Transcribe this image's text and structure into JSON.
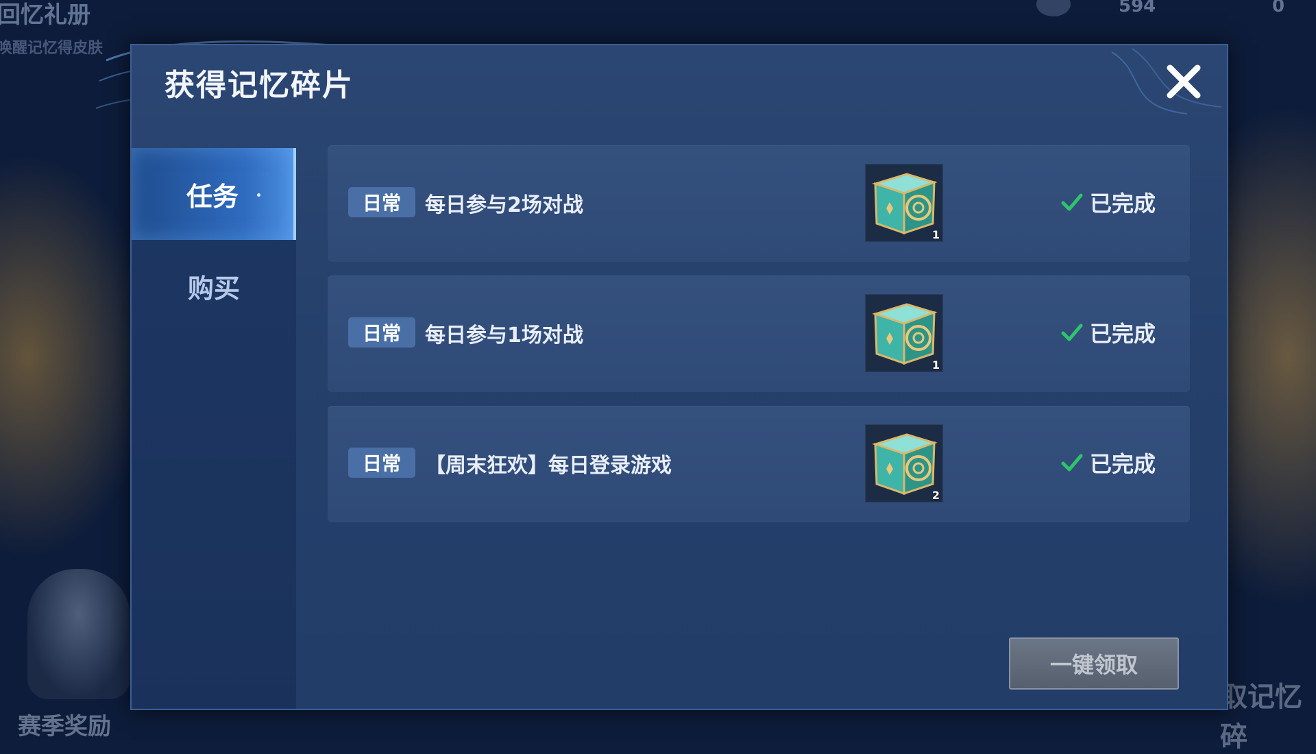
{
  "background": {
    "title": "回忆礼册",
    "subtitle": "唤醒记忆得皮肤",
    "currency_1": "594",
    "currency_2": "0",
    "season_label": "赛季奖励",
    "right_label": "取记忆碎"
  },
  "dialog": {
    "title": "获得记忆碎片",
    "close_icon": "close-icon"
  },
  "sidebar": {
    "tabs": [
      {
        "label": "任务",
        "selected": true
      },
      {
        "label": "购买",
        "selected": false
      }
    ]
  },
  "tasks": [
    {
      "badge": "日常",
      "name": "每日参与2场对战",
      "reward_icon": "chest-icon",
      "reward_count": "1",
      "status": "已完成"
    },
    {
      "badge": "日常",
      "name": "每日参与1场对战",
      "reward_icon": "chest-icon",
      "reward_count": "1",
      "status": "已完成"
    },
    {
      "badge": "日常",
      "name": "【周末狂欢】每日登录游戏",
      "reward_icon": "chest-icon",
      "reward_count": "2",
      "status": "已完成"
    }
  ],
  "claim_button": {
    "label": "一键领取",
    "enabled": false
  },
  "colors": {
    "check": "#2fc46b",
    "accent": "#4c8ee0",
    "panel": "#24406b"
  }
}
